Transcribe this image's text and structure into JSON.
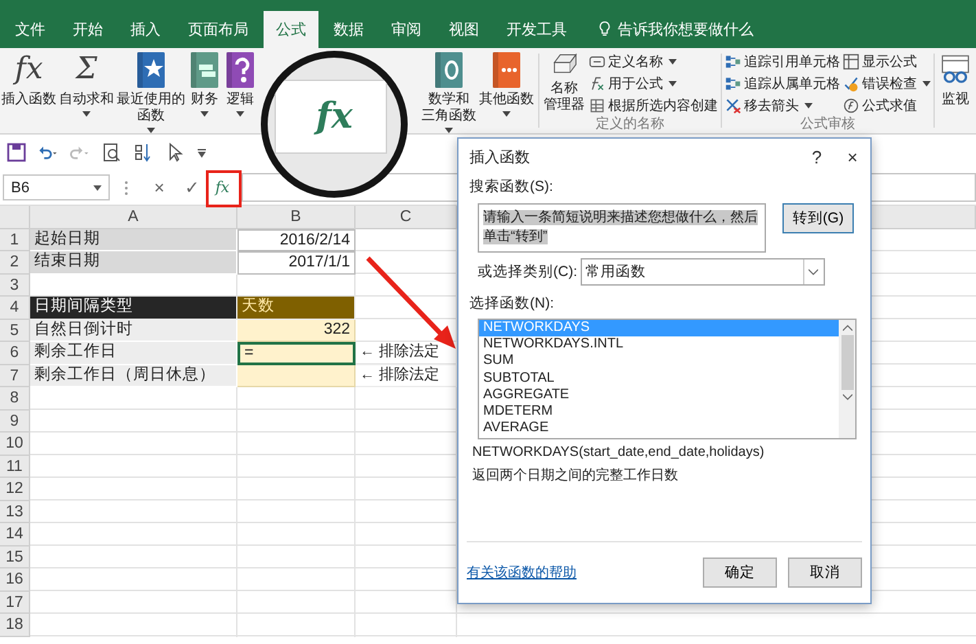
{
  "ribbon_tabs": [
    {
      "label": "文件",
      "selected": false
    },
    {
      "label": "开始",
      "selected": false
    },
    {
      "label": "插入",
      "selected": false
    },
    {
      "label": "页面布局",
      "selected": false
    },
    {
      "label": "公式",
      "selected": true
    },
    {
      "label": "数据",
      "selected": false
    },
    {
      "label": "审阅",
      "selected": false
    },
    {
      "label": "视图",
      "selected": false
    },
    {
      "label": "开发工具",
      "selected": false
    }
  ],
  "tell_me": "告诉我你想要做什么",
  "function_library": {
    "left": [
      {
        "lines": [
          "插入函数"
        ],
        "kind": "glyph",
        "glyph": "fx",
        "dropdown": false
      },
      {
        "lines": [
          "自动求和"
        ],
        "kind": "glyph",
        "glyph": "Σ",
        "dropdown": true
      },
      {
        "lines": [
          "最近使用的",
          "函数"
        ],
        "kind": "star-book",
        "dropdown": true
      },
      {
        "lines": [
          "财务"
        ],
        "kind": "stack-book",
        "dropdown": true
      },
      {
        "lines": [
          "逻辑"
        ],
        "kind": "question-book",
        "dropdown": true
      }
    ],
    "right": [
      {
        "lines": [
          "数学和",
          "三角函数"
        ],
        "kind": "theta-book",
        "dropdown": true
      },
      {
        "lines": [
          "其他函数"
        ],
        "kind": "dots-book",
        "dropdown": true
      }
    ]
  },
  "defined_names": {
    "manager_lines": [
      "名称",
      "管理器"
    ],
    "items": [
      {
        "label": "定义名称",
        "kind": "tag",
        "dropdown": true
      },
      {
        "label": "用于公式",
        "kind": "formula",
        "dropdown": true
      },
      {
        "label": "根据所选内容创建",
        "kind": "grid",
        "dropdown": false
      }
    ],
    "group_label": "定义的名称"
  },
  "formula_auditing": {
    "columns": [
      [
        {
          "label": "追踪引用单元格",
          "kind": "trace",
          "dropdown": false
        },
        {
          "label": "追踪从属单元格",
          "kind": "trace",
          "dropdown": false
        },
        {
          "label": "移去箭头",
          "kind": "remove",
          "dropdown": true
        }
      ],
      [
        {
          "label": "显示公式",
          "kind": "show",
          "dropdown": false
        },
        {
          "label": "错误检查",
          "kind": "error",
          "dropdown": true
        },
        {
          "label": "公式求值",
          "kind": "evaluate",
          "dropdown": false
        }
      ]
    ],
    "group_label": "公式审核"
  },
  "watch_window": "监视",
  "name_box": "B6",
  "formula_bar": {
    "cancel": "×",
    "enter": "✓",
    "insert_function": "fx"
  },
  "magnifier": {
    "label": "fx"
  },
  "columns": [
    "A",
    "B",
    "C"
  ],
  "rows": [
    {
      "number": "1",
      "cells": [
        {
          "text": "起始日期",
          "kind": "label",
          "selected": false
        },
        {
          "text": "2016/2/14",
          "kind": "date",
          "selected": false
        }
      ]
    },
    {
      "number": "2",
      "cells": [
        {
          "text": "结束日期",
          "kind": "label",
          "selected": false
        },
        {
          "text": "2017/1/1",
          "kind": "date",
          "selected": false
        }
      ]
    },
    {
      "number": "3"
    },
    {
      "number": "4",
      "cells": [
        {
          "text": "日期间隔类型",
          "kind": "head-label",
          "selected": false
        },
        {
          "text": "天数",
          "kind": "head-value",
          "selected": false
        }
      ]
    },
    {
      "number": "5",
      "cells": [
        {
          "text": "自然日倒计时",
          "kind": "row-label",
          "selected": false
        },
        {
          "text": "322",
          "kind": "input",
          "selected": false
        }
      ]
    },
    {
      "number": "6",
      "cells": [
        {
          "text": "剩余工作日",
          "kind": "row-label",
          "selected": false
        },
        {
          "text": "=",
          "kind": "input",
          "selected": true
        },
        {
          "text": "← 排除法定",
          "kind": "note",
          "selected": false
        }
      ]
    },
    {
      "number": "7",
      "cells": [
        {
          "text": "剩余工作日（周日休息）",
          "kind": "row-label",
          "selected": false
        },
        {
          "text": "",
          "kind": "input",
          "selected": false
        },
        {
          "text": "← 排除法定",
          "kind": "note",
          "selected": false
        }
      ]
    },
    {
      "number": "8"
    },
    {
      "number": "9"
    },
    {
      "number": "10"
    },
    {
      "number": "11"
    },
    {
      "number": "12"
    },
    {
      "number": "13"
    },
    {
      "number": "14"
    },
    {
      "number": "15"
    },
    {
      "number": "16"
    },
    {
      "number": "17"
    },
    {
      "number": "18"
    }
  ],
  "dialog": {
    "title": "插入函数",
    "help": "?",
    "close": "×",
    "search_label": "搜索函数(S):",
    "search_value": "请输入一条简短说明来描述您想做什么，然后单击“转到”",
    "go_button": "转到(G)",
    "category_label": "或选择类别(C):",
    "category_value": "常用函数",
    "function_label": "选择函数(N):",
    "functions": [
      {
        "name": "NETWORKDAYS",
        "selected": true
      },
      {
        "name": "NETWORKDAYS.INTL",
        "selected": false
      },
      {
        "name": "SUM",
        "selected": false
      },
      {
        "name": "SUBTOTAL",
        "selected": false
      },
      {
        "name": "AGGREGATE",
        "selected": false
      },
      {
        "name": "MDETERM",
        "selected": false
      },
      {
        "name": "AVERAGE",
        "selected": false
      }
    ],
    "signature": "NETWORKDAYS(start_date,end_date,holidays)",
    "description": "返回两个日期之间的完整工作日数",
    "help_link": "有关该函数的帮助",
    "ok": "确定",
    "cancel": "取消"
  }
}
